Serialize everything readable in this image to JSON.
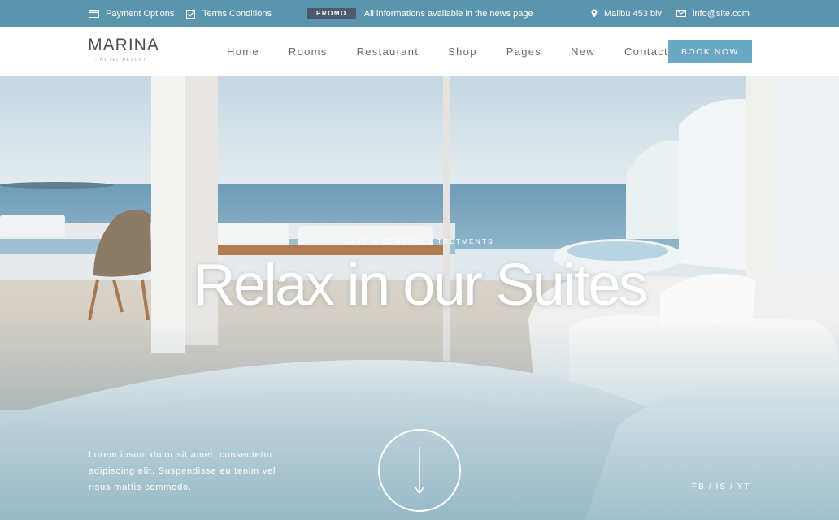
{
  "topbar": {
    "payment": {
      "label": "Payment Options",
      "icon": "credit-card-icon"
    },
    "terms": {
      "label": "Terms Conditions",
      "icon": "checkbox-icon"
    },
    "promo": {
      "badge": "PROMO",
      "text": "All informations available in the news page"
    },
    "address": {
      "label": "Malibu 453 blv",
      "icon": "map-pin-icon"
    },
    "email": {
      "label": "info@site.com",
      "icon": "envelope-icon"
    }
  },
  "header": {
    "logo": {
      "main": "MARINA",
      "sub": "· HOTEL RESORT ·"
    },
    "nav": [
      "Home",
      "Rooms",
      "Restaurant",
      "Shop",
      "Pages",
      "New",
      "Contact"
    ],
    "cta": "BOOK NOW"
  },
  "hero": {
    "kicker": "SAFE & CERTIFIED TRETMENTS",
    "title": "Relax in our Suites",
    "description": "Lorem ipsum dolor sit amet, consectetur adipiscing elit. Suspendisse eu tenim vel risus mattis commodo.",
    "scroll_icon": "arrow-down-icon",
    "social": [
      "FB",
      "IS",
      "YT"
    ],
    "separator": "/"
  },
  "colors": {
    "topbar": "#5b95ad",
    "accent": "#6aa8c4",
    "promo_badge": "#4b5a6e",
    "nav_text": "#666c73"
  }
}
